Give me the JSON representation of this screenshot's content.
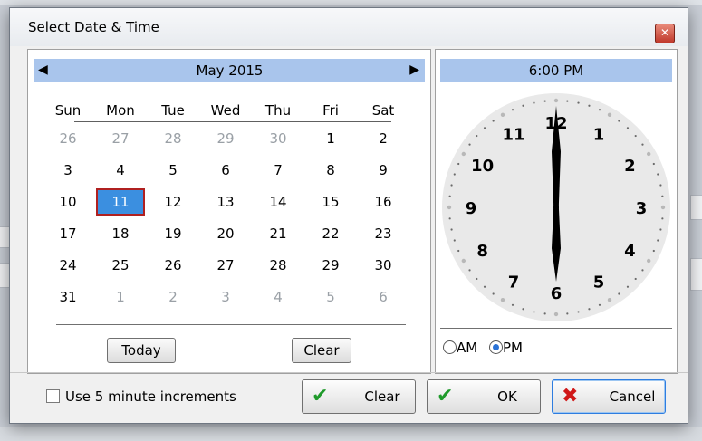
{
  "dialog": {
    "title": "Select Date & Time",
    "close_glyph": "✕"
  },
  "calendar": {
    "month_label": "May 2015",
    "prev_glyph": "◀",
    "next_glyph": "▶",
    "day_headers": [
      "Sun",
      "Mon",
      "Tue",
      "Wed",
      "Thu",
      "Fri",
      "Sat"
    ],
    "weeks": [
      [
        "26",
        "27",
        "28",
        "29",
        "30",
        "1",
        "2"
      ],
      [
        "3",
        "4",
        "5",
        "6",
        "7",
        "8",
        "9"
      ],
      [
        "10",
        "11",
        "12",
        "13",
        "14",
        "15",
        "16"
      ],
      [
        "17",
        "18",
        "19",
        "20",
        "21",
        "22",
        "23"
      ],
      [
        "24",
        "25",
        "26",
        "27",
        "28",
        "29",
        "30"
      ],
      [
        "31",
        "1",
        "2",
        "3",
        "4",
        "5",
        "6"
      ]
    ],
    "selected_day": "11",
    "today_label": "Today",
    "clear_label": "Clear"
  },
  "clock": {
    "time_label": "6:00 PM",
    "numbers": [
      "12",
      "1",
      "2",
      "3",
      "4",
      "5",
      "6",
      "7",
      "8",
      "9",
      "10",
      "11"
    ],
    "hour": 6,
    "minute": 0,
    "am_label": "AM",
    "pm_label": "PM",
    "selected_period": "PM"
  },
  "footer": {
    "increments_label": "Use 5 minute increments",
    "increments_checked": false,
    "clear_label": "Clear",
    "ok_label": "OK",
    "cancel_label": "Cancel"
  },
  "colors": {
    "header_bg": "#a9c5ec",
    "selected_bg": "#3b8fe0",
    "selected_border": "#b02020",
    "muted_text": "#9aa0a6",
    "clock_face": "#e9e9e9",
    "ok_icon": "#1f9a2b",
    "cancel_icon": "#d01818"
  }
}
